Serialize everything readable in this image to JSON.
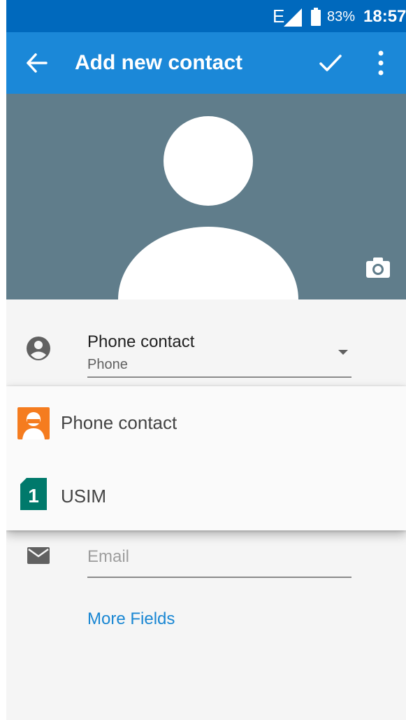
{
  "status_bar": {
    "network": "E",
    "battery": "83%",
    "time": "18:57"
  },
  "app_bar": {
    "title": "Add new contact"
  },
  "account": {
    "label": "Phone contact",
    "sub": "Phone"
  },
  "email": {
    "placeholder": "Email",
    "value": ""
  },
  "more_fields": "More Fields",
  "account_menu": {
    "items": [
      {
        "label": "Phone contact",
        "icon": "phone-contact-icon"
      },
      {
        "label": "USIM",
        "icon": "sim-1-icon",
        "badge": "1"
      }
    ]
  },
  "colors": {
    "status_bar": "#0069bd",
    "app_bar": "#1b88d8",
    "photo_bg": "#607d8b",
    "accent": "#1a87d3",
    "phone_contact": "#f57c1f",
    "usim": "#00796b"
  }
}
